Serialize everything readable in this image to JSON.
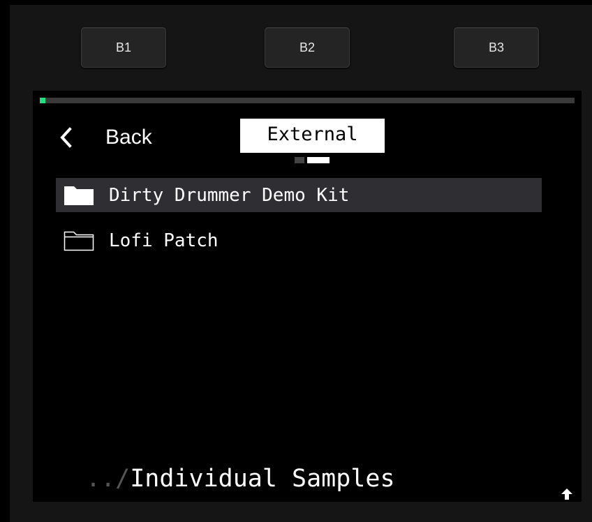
{
  "hardware_buttons": [
    {
      "label": "B1"
    },
    {
      "label": "B2"
    },
    {
      "label": "B3"
    }
  ],
  "screen": {
    "progress_fraction": 0.01,
    "colors": {
      "progress": "#22e07a",
      "selected_row": "#2f2f33"
    },
    "back": {
      "icon": "chevron-left-icon",
      "label": "Back"
    },
    "location_tab": {
      "label": "External"
    },
    "page_indicator": {
      "count": 2,
      "active_index": 1
    },
    "items": [
      {
        "name": "Dirty Drummer Demo Kit",
        "icon": "folder-filled-icon",
        "selected": true
      },
      {
        "name": "Lofi Patch",
        "icon": "folder-outline-icon",
        "selected": false
      }
    ],
    "path": {
      "parent": "../",
      "current": "Individual Samples"
    },
    "corner_icon": "arrow-up-icon"
  }
}
